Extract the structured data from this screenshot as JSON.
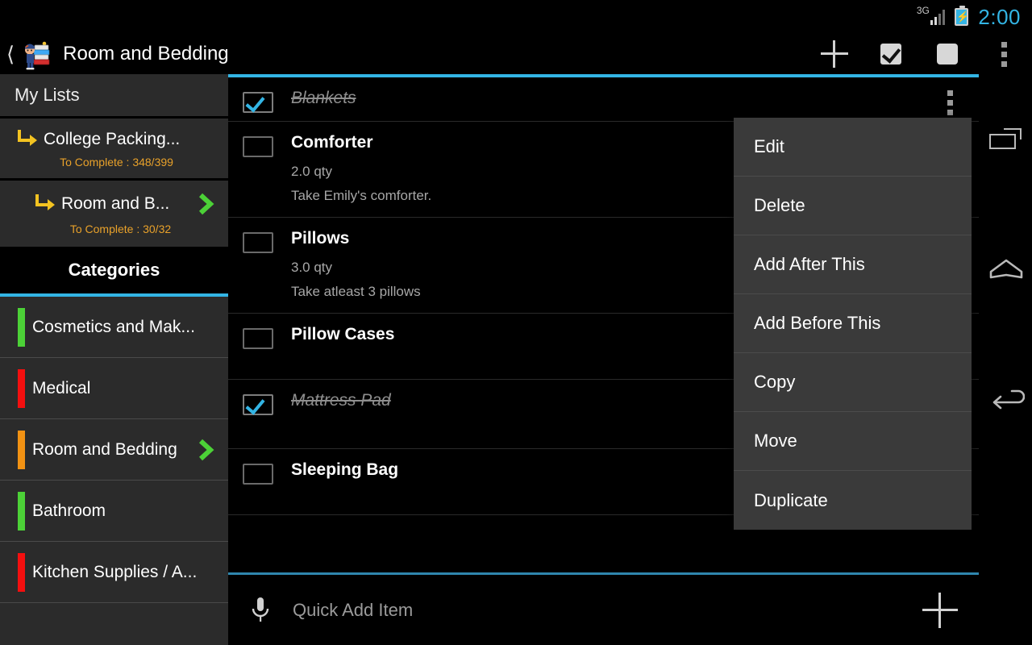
{
  "statusbar": {
    "network": "3G",
    "time": "2:00",
    "battery_icon": "battery-charging-icon",
    "signal_icon": "signal-bars-icon"
  },
  "actionbar": {
    "back_icon": "back-chevron-icon",
    "logo_icon": "app-logo-icon",
    "title": "Room and Bedding",
    "actions": [
      {
        "name": "add-item-button",
        "icon": "plus-icon"
      },
      {
        "name": "check-all-button",
        "icon": "checkbox-checked-icon"
      },
      {
        "name": "uncheck-all-button",
        "icon": "checkbox-empty-icon"
      },
      {
        "name": "overflow-menu-button",
        "icon": "three-dots-vertical-icon"
      }
    ],
    "divider_color": "#33b5e5"
  },
  "sidebar": {
    "header": "My Lists",
    "lists": [
      {
        "title": "College Packing...",
        "subtitle": "To Complete : 348/399",
        "arrow_icon": "sublist-arrow-icon",
        "selected": false
      },
      {
        "title": "Room and B...",
        "subtitle": "To Complete : 30/32",
        "arrow_icon": "sublist-arrow-icon",
        "selected": true,
        "chevron_icon": "chevron-right-icon"
      }
    ],
    "categories_tab": "Categories",
    "categories": [
      {
        "label": "Cosmetics and Mak...",
        "color": "#4cd137",
        "selected": false
      },
      {
        "label": "Medical",
        "color": "#f40f0f",
        "selected": false
      },
      {
        "label": "Room and Bedding",
        "color": "#f29213",
        "selected": true,
        "chevron_icon": "chevron-right-icon"
      },
      {
        "label": "Bathroom",
        "color": "#4cd137",
        "selected": false
      },
      {
        "label": "Kitchen Supplies / A...",
        "color": "#f40f0f",
        "selected": false
      }
    ]
  },
  "main": {
    "items": [
      {
        "title": "Blankets",
        "qty": "",
        "note": "",
        "checked": true,
        "has_dots": true
      },
      {
        "title": "Comforter",
        "qty": "2.0 qty",
        "note": "Take Emily's comforter.",
        "checked": false,
        "has_dots": false
      },
      {
        "title": "Pillows",
        "qty": "3.0 qty",
        "note": "Take atleast 3 pillows",
        "checked": false,
        "has_dots": false
      },
      {
        "title": "Pillow Cases",
        "qty": "",
        "note": "",
        "checked": false,
        "has_dots": false
      },
      {
        "title": "Mattress Pad",
        "qty": "",
        "note": "",
        "checked": true,
        "has_dots": false
      },
      {
        "title": "Sleeping Bag",
        "qty": "",
        "note": "",
        "checked": false,
        "has_dots": false
      }
    ]
  },
  "context_menu": {
    "items": [
      "Edit",
      "Delete",
      "Add After This",
      "Add Before This",
      "Copy",
      "Move",
      "Duplicate"
    ]
  },
  "quick_add": {
    "mic_icon": "microphone-icon",
    "placeholder": "Quick Add Item",
    "add_icon": "plus-icon"
  },
  "navbar": {
    "buttons": [
      {
        "name": "recents-button",
        "icon": "recents-icon"
      },
      {
        "name": "home-button",
        "icon": "home-icon"
      },
      {
        "name": "back-button",
        "icon": "back-arrow-icon"
      }
    ]
  }
}
